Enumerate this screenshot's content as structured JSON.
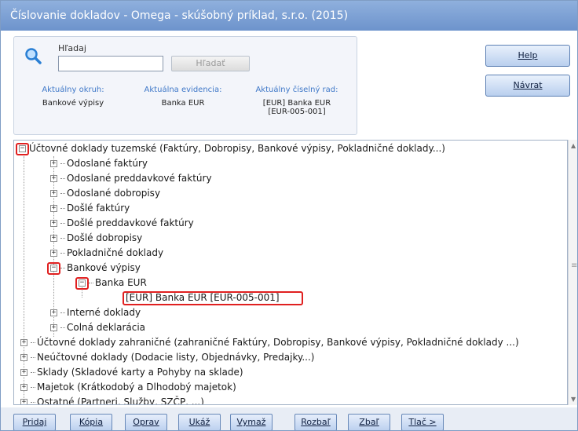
{
  "window": {
    "title": "Číslovanie dokladov - Omega - skúšobný príklad, s.r.o. (2015)"
  },
  "search": {
    "label": "Hľadaj",
    "value": "",
    "button_label": "Hľadať"
  },
  "info": [
    {
      "label": "Aktuálny okruh:",
      "value": "Bankové výpisy"
    },
    {
      "label": "Aktuálna evidencia:",
      "value": "Banka EUR"
    },
    {
      "label": "Aktuálny číselný rad:",
      "value": "[EUR] Banka EUR",
      "value2": "[EUR-005-001]"
    }
  ],
  "side_buttons": {
    "help": "Help",
    "back": "Návrat"
  },
  "tree": [
    {
      "label": "Účtovné doklady tuzemské (Faktúry, Dobropisy, Bankové výpisy, Pokladničné doklady...)",
      "sign": "−"
    },
    {
      "label": "Odoslané faktúry",
      "sign": "+"
    },
    {
      "label": "Odoslané preddavkové faktúry",
      "sign": "+"
    },
    {
      "label": "Odoslané dobropisy",
      "sign": "+"
    },
    {
      "label": "Došlé faktúry",
      "sign": "+"
    },
    {
      "label": "Došlé preddavkové faktúry",
      "sign": "+"
    },
    {
      "label": "Došlé dobropisy",
      "sign": "+"
    },
    {
      "label": "Pokladničné doklady",
      "sign": "+"
    },
    {
      "label": "Bankové výpisy",
      "sign": "−"
    },
    {
      "label": "Banka EUR",
      "sign": "−"
    },
    {
      "label": "[EUR] Banka EUR [EUR-005-001]",
      "sign": ""
    },
    {
      "label": "Interné doklady",
      "sign": "+"
    },
    {
      "label": "Colná deklarácia",
      "sign": "+"
    },
    {
      "label": "Účtovné doklady zahraničné (zahraničné Faktúry, Dobropisy, Bankové výpisy, Pokladničné doklady ...)",
      "sign": "+"
    },
    {
      "label": "Neúčtovné doklady (Dodacie listy, Objednávky, Predajky...)",
      "sign": "+"
    },
    {
      "label": "Sklady (Skladové karty a Pohyby na sklade)",
      "sign": "+"
    },
    {
      "label": "Majetok (Krátkodobý a Dlhodobý majetok)",
      "sign": "+"
    },
    {
      "label": "Ostatné (Partneri, Služby, SZČP, ...)",
      "sign": "+"
    }
  ],
  "bottom_buttons": [
    {
      "label": "Pridaj"
    },
    {
      "label": "Kópia"
    },
    {
      "label": "Oprav"
    },
    {
      "label": "Ukáž"
    },
    {
      "label": "Vymaž"
    },
    {
      "label": "Rozbaľ"
    },
    {
      "label": "Zbaľ"
    },
    {
      "label": "Tlač >"
    }
  ],
  "colors": {
    "titlebar": "#7aa0d6",
    "highlight": "#e02020",
    "label_blue": "#3f78c8"
  }
}
